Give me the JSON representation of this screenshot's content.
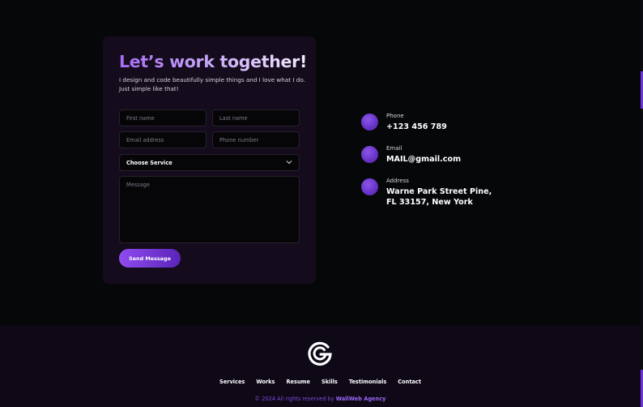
{
  "contact_form": {
    "heading": "Let’s work together!",
    "intro": "I design and code beautifully simple things and I love what I do. Just simple like that!",
    "first_name_placeholder": "First name",
    "last_name_placeholder": "Last name",
    "email_placeholder": "Email address",
    "phone_placeholder": "Phone number",
    "service_selected": "Choose Service",
    "message_placeholder": "Message",
    "send_label": "Send Message"
  },
  "contact_info": [
    {
      "label": "Phone",
      "value": "+123 456 789"
    },
    {
      "label": "Email",
      "value": "MAIL@gmail.com"
    },
    {
      "label": "Address",
      "value_line1": "Warne Park Street Pine,",
      "value_line2": "FL 33157, New York"
    }
  ],
  "footer": {
    "logo_icon": "g-logo-icon",
    "nav": [
      "Services",
      "Works",
      "Resume",
      "Skills",
      "Testimonials",
      "Contact"
    ],
    "copyright_prefix": "© 2024 All rights reserved by ",
    "agency": "WallWeb Agency"
  },
  "colors": {
    "accent": "#8f4cf0",
    "accent_dark": "#5a24b8",
    "background": "#050709",
    "card": "#140c1c",
    "footer": "#0f0817"
  }
}
